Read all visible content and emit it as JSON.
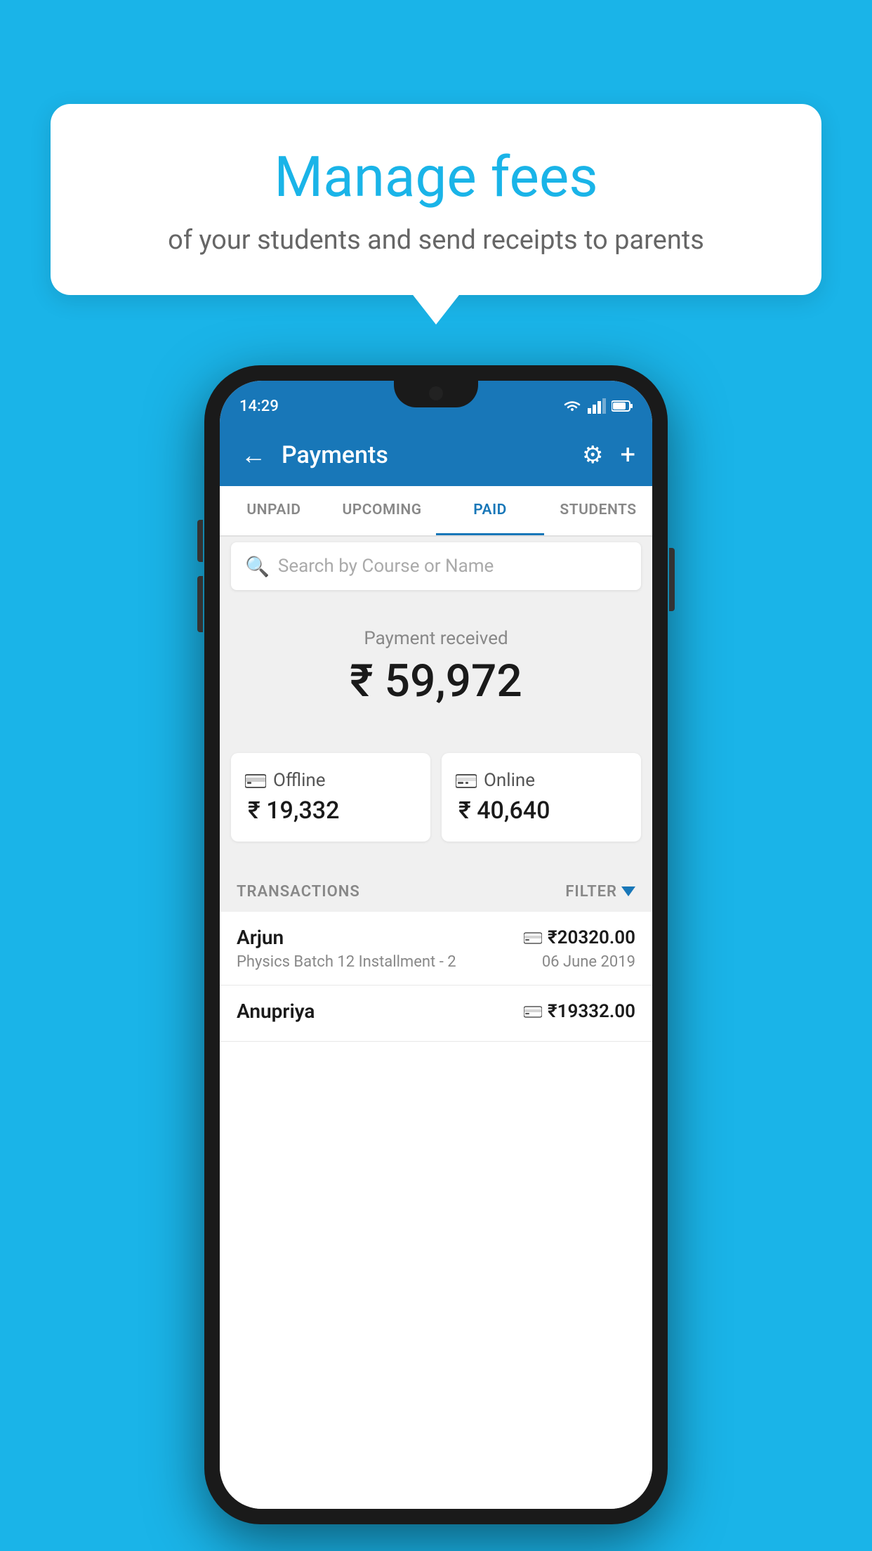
{
  "page": {
    "background_color": "#1ab4e8"
  },
  "speech_bubble": {
    "title": "Manage fees",
    "subtitle": "of your students and send receipts to parents"
  },
  "status_bar": {
    "time": "14:29"
  },
  "app_bar": {
    "title": "Payments",
    "back_label": "←",
    "plus_label": "+",
    "gear_label": "⚙"
  },
  "tabs": [
    {
      "label": "UNPAID",
      "active": false
    },
    {
      "label": "UPCOMING",
      "active": false
    },
    {
      "label": "PAID",
      "active": true
    },
    {
      "label": "STUDENTS",
      "active": false
    }
  ],
  "search": {
    "placeholder": "Search by Course or Name"
  },
  "payment_received": {
    "label": "Payment received",
    "amount": "₹ 59,972"
  },
  "payment_cards": [
    {
      "icon": "💳",
      "label": "Offline",
      "amount": "₹ 19,332"
    },
    {
      "icon": "💳",
      "label": "Online",
      "amount": "₹ 40,640"
    }
  ],
  "transactions": {
    "label": "TRANSACTIONS",
    "filter_label": "FILTER"
  },
  "transaction_list": [
    {
      "name": "Arjun",
      "icon": "💳",
      "amount": "₹20320.00",
      "course": "Physics Batch 12 Installment - 2",
      "date": "06 June 2019"
    },
    {
      "name": "Anupriya",
      "icon": "💳",
      "amount": "₹19332.00",
      "course": "",
      "date": ""
    }
  ]
}
